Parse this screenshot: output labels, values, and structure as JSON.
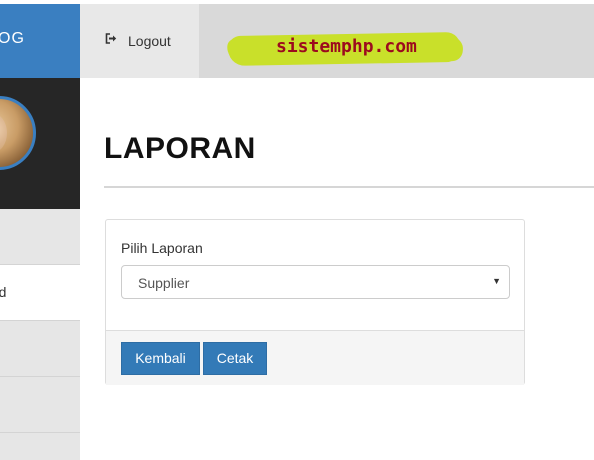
{
  "sidebar": {
    "brand": "OG",
    "items": [
      {
        "label": ""
      },
      {
        "label": "rd"
      },
      {
        "label": ""
      },
      {
        "label": ""
      }
    ]
  },
  "header": {
    "logout_icon": "sign-out-icon",
    "logout_label": "Logout",
    "watermark": "sistemphp.com"
  },
  "main": {
    "title": "LAPORAN",
    "form": {
      "label": "Pilih Laporan",
      "selected": "Supplier",
      "back_label": "Kembali",
      "print_label": "Cetak"
    }
  },
  "colors": {
    "brand_blue": "#3a7fc1",
    "button_blue": "#337ab7",
    "sidebar_dark": "#262626",
    "watermark_text": "#9c0a1e",
    "watermark_brush": "#c9e02a"
  }
}
